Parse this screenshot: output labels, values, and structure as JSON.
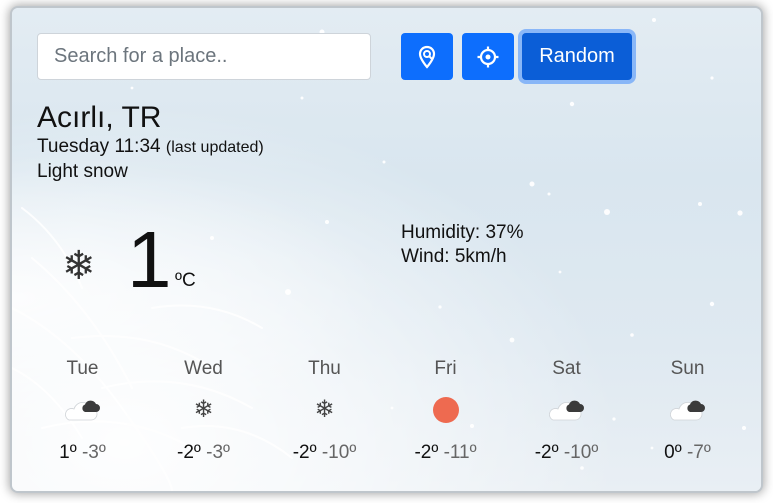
{
  "search": {
    "placeholder": "Search for a place.."
  },
  "toolbar": {
    "random_label": "Random"
  },
  "location": {
    "city": "Acırlı, TR",
    "time": "Tuesday 11:34",
    "updated_note": "(last updated)",
    "condition": "Light snow"
  },
  "current": {
    "icon": "snowflake-icon",
    "temp": "1",
    "unit": "ºC",
    "humidity": "Humidity: 37%",
    "wind": "Wind: 5km/h"
  },
  "forecast": [
    {
      "day": "Tue",
      "icon": "cloud-dark-cloud-icon",
      "hi": "1º",
      "lo": "-3º"
    },
    {
      "day": "Wed",
      "icon": "snowflake-icon",
      "hi": "-2º",
      "lo": "-3º"
    },
    {
      "day": "Thu",
      "icon": "snowflake-icon",
      "hi": "-2º",
      "lo": "-10º"
    },
    {
      "day": "Fri",
      "icon": "sun-icon",
      "hi": "-2º",
      "lo": "-11º"
    },
    {
      "day": "Sat",
      "icon": "cloud-dark-cloud-icon",
      "hi": "-2º",
      "lo": "-10º"
    },
    {
      "day": "Sun",
      "icon": "cloud-dark-cloud-icon",
      "hi": "0º",
      "lo": "-7º"
    }
  ],
  "colors": {
    "primary": "#0d6efd",
    "primary_active": "#0b5ed7",
    "sun": "#ee6a50"
  }
}
